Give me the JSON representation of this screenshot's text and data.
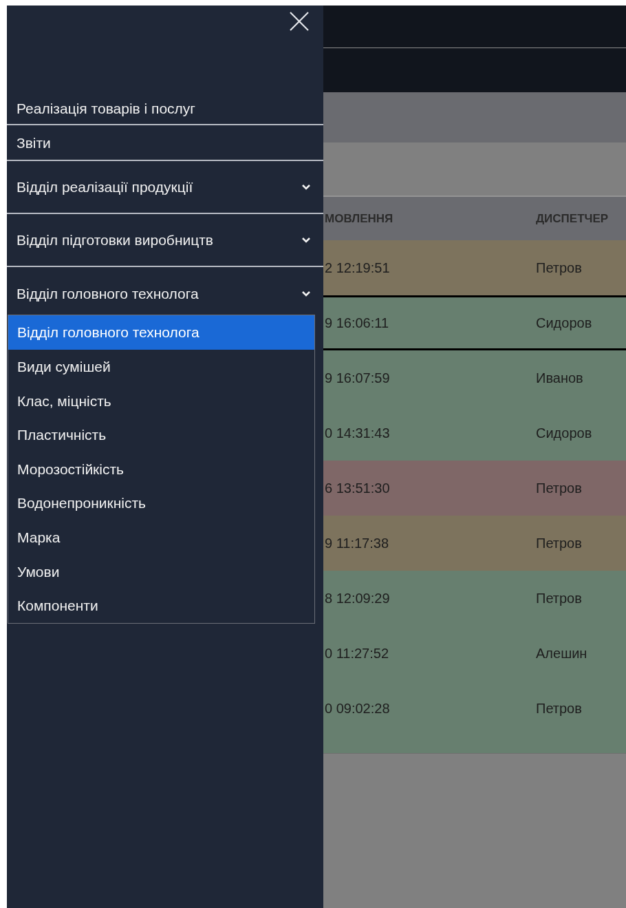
{
  "sidebar": {
    "items": [
      {
        "label": "Реалізація товарів і послуг",
        "kind": "link"
      },
      {
        "label": "Звіти",
        "kind": "link"
      },
      {
        "label": "Відділ реалізації продукції",
        "kind": "group",
        "expanded": false
      },
      {
        "label": "Відділ підготовки виробництв",
        "kind": "group",
        "expanded": false
      },
      {
        "label": "Відділ головного технолога",
        "kind": "group",
        "expanded": true,
        "children": [
          {
            "label": "Відділ головного технолога",
            "selected": true
          },
          {
            "label": "Види сумішей",
            "selected": false
          },
          {
            "label": "Клас, міцність",
            "selected": false
          },
          {
            "label": "Пластичність",
            "selected": false
          },
          {
            "label": "Морозостійкість",
            "selected": false
          },
          {
            "label": "Водонепроникність",
            "selected": false
          },
          {
            "label": "Марка",
            "selected": false
          },
          {
            "label": "Умови",
            "selected": false
          },
          {
            "label": "Компоненти",
            "selected": false
          }
        ]
      }
    ]
  },
  "table": {
    "columns": [
      "МОВЛЕННЯ",
      "ДИСПЕТЧЕР"
    ],
    "rows": [
      {
        "cells": [
          "2 12:19:51",
          "Петров"
        ],
        "color": "#7d735d",
        "selected": false
      },
      {
        "cells": [
          "9 16:06:11",
          "Сидоров"
        ],
        "color": "#677f6f",
        "selected": true
      },
      {
        "cells": [
          "9 16:07:59",
          "Иванов"
        ],
        "color": "#677f6f",
        "selected": false
      },
      {
        "cells": [
          "0 14:31:43",
          "Сидоров"
        ],
        "color": "#677f6f",
        "selected": false
      },
      {
        "cells": [
          "6 13:51:30",
          "Петров"
        ],
        "color": "#7f6767",
        "selected": false
      },
      {
        "cells": [
          "9 11:17:38",
          "Петров"
        ],
        "color": "#7d735d",
        "selected": false
      },
      {
        "cells": [
          "8 12:09:29",
          "Петров"
        ],
        "color": "#677f6f",
        "selected": false
      },
      {
        "cells": [
          "0 11:27:52",
          "Алешин"
        ],
        "color": "#677f6f",
        "selected": false
      },
      {
        "cells": [
          "0 09:02:28",
          "Петров"
        ],
        "color": "#677f6f",
        "selected": false
      }
    ]
  }
}
